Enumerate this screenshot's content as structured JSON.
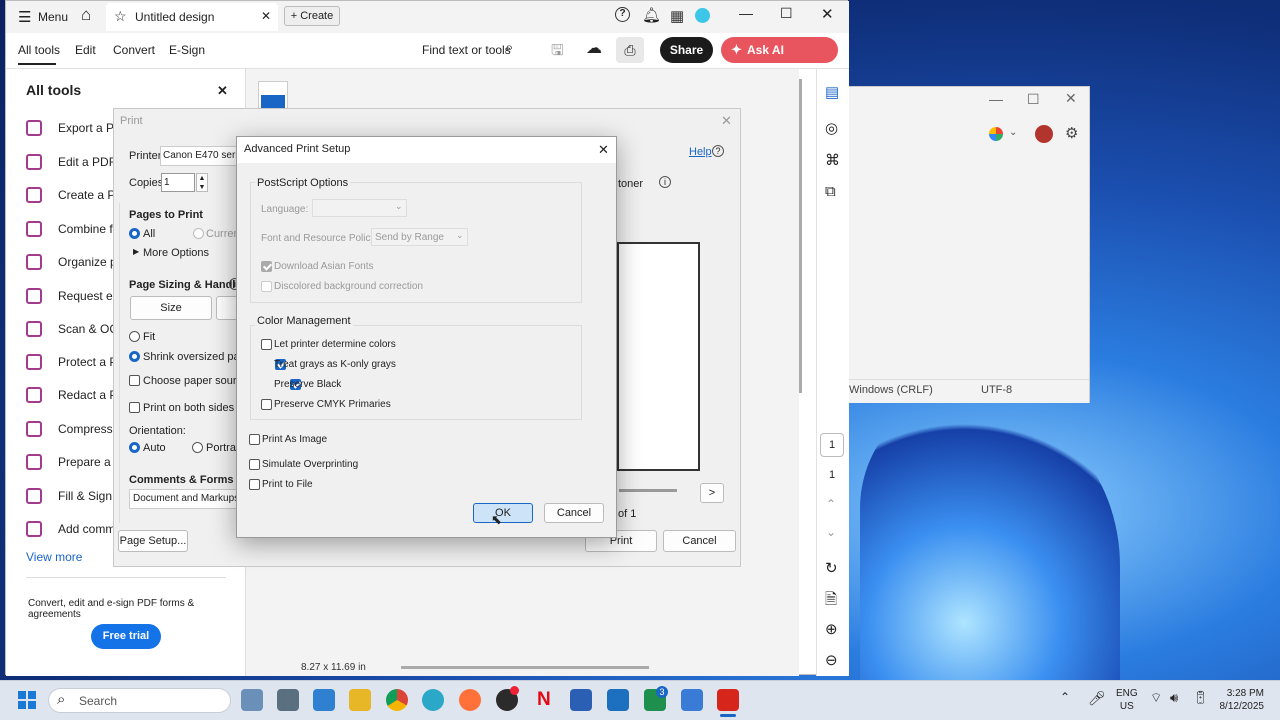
{
  "window": {
    "menu_label": "Menu",
    "tab_title": "Untitled design",
    "create_label": "Create"
  },
  "toolbar": {
    "tabs": [
      "All tools",
      "Edit",
      "Convert",
      "E-Sign"
    ],
    "find_label": "Find text or tools",
    "share_label": "Share",
    "ai_label": "Ask AI Assistant"
  },
  "left_panel": {
    "title": "All tools",
    "items": [
      "Export a PDF",
      "Edit a PDF",
      "Create a PDF",
      "Combine files",
      "Organize pages",
      "Request e-signatures",
      "Scan & OCR",
      "Protect a PDF",
      "Redact a PDF",
      "Compress a PDF",
      "Prepare a form",
      "Fill & Sign",
      "Add comments"
    ],
    "view_more": "View more",
    "promo": "Convert, edit and e-sign PDF forms & agreements",
    "free_trial": "Free trial"
  },
  "viewer": {
    "page_size": "8.27 x 11.69 in",
    "page_current": "1",
    "page_total": "1"
  },
  "print_dialog": {
    "title": "Print",
    "help": "Help",
    "printer_label": "Printer:",
    "printer_value": "Canon E470 series",
    "copies_label": "Copies:",
    "copies_value": "1",
    "pages_title": "Pages to Print",
    "all": "All",
    "current": "Current",
    "more_options": "More Options",
    "sizing_title": "Page Sizing & Handling",
    "size_btn": "Size",
    "fit": "Fit",
    "shrink": "Shrink oversized pages",
    "choose_paper": "Choose paper source by",
    "both_sides": "Print on both sides of pa",
    "orientation": "Orientation:",
    "auto": "Auto",
    "portrait": "Portrait",
    "comments_title": "Comments & Forms",
    "comments_value": "Document and Markups",
    "toner": "toner",
    "page_of": "of 1",
    "page_setup": "Page Setup...",
    "print_btn": "Print",
    "cancel_btn": "Cancel",
    "next_btn": ">"
  },
  "advanced_dialog": {
    "title": "Advanced Print Setup",
    "ps_group": "PostScript Options",
    "language_label": "Language:",
    "font_policy_label": "Font and Resource Policy:",
    "font_policy_value": "Send by Range",
    "download_asian": "Download Asian Fonts",
    "discolored": "Discolored background correction",
    "color_group": "Color Management",
    "let_printer": "Let printer determine colors",
    "treat_grays": "Treat grays as K-only grays",
    "preserve_black": "Preserve Black",
    "preserve_cmyk": "Preserve CMYK Primaries",
    "print_as_image": "Print As Image",
    "simulate": "Simulate Overprinting",
    "print_to_file": "Print to File",
    "ok": "OK",
    "cancel": "Cancel"
  },
  "notepad": {
    "line_ending": "Windows (CRLF)",
    "encoding": "UTF-8"
  },
  "taskbar": {
    "search_placeholder": "Search",
    "lang_1": "ENG",
    "lang_2": "US",
    "time": "3:28 PM",
    "date": "8/12/2025",
    "badge": "3"
  },
  "colors": {
    "accent": "#1a66c7",
    "ai_button": "#e8555f",
    "share_button": "#1b1b1b",
    "free_trial": "#1473e6"
  }
}
